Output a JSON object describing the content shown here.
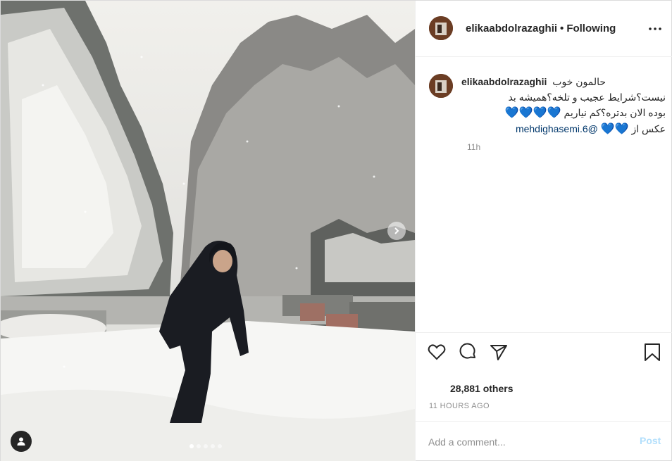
{
  "post": {
    "username": "elikaabdolrazaghii",
    "separator": "•",
    "follow_state": "Following",
    "caption_user": "elikaabdolrazaghii",
    "caption_line1": "حالمون خوب",
    "caption_line2": "نیست؟شرایط عجیب و تلخه؟همیشه بد",
    "caption_line3": "بوده الان بدتره؟کم نیاریم",
    "caption_line3_hearts": "💙💙💙💙",
    "caption_line4_text": "عکس از",
    "caption_line4_hearts": "💙💙",
    "mention": "@mehdighasemi.6",
    "caption_time": "11h",
    "likes": "28,881 others",
    "time_ago": "11 HOURS AGO",
    "comment_placeholder": "Add a comment...",
    "post_label": "Post"
  },
  "carousel": {
    "count": 5,
    "active": 0
  },
  "icons": {
    "more": "more-options-icon",
    "like": "heart-icon",
    "comment": "comment-icon",
    "share": "share-icon",
    "save": "bookmark-icon",
    "next": "chevron-right-icon",
    "tags": "user-tag-icon"
  },
  "colors": {
    "link": "#00376b",
    "heart": "#1da7df",
    "post_button": "#b2dffc",
    "muted": "#8e8e8e"
  }
}
